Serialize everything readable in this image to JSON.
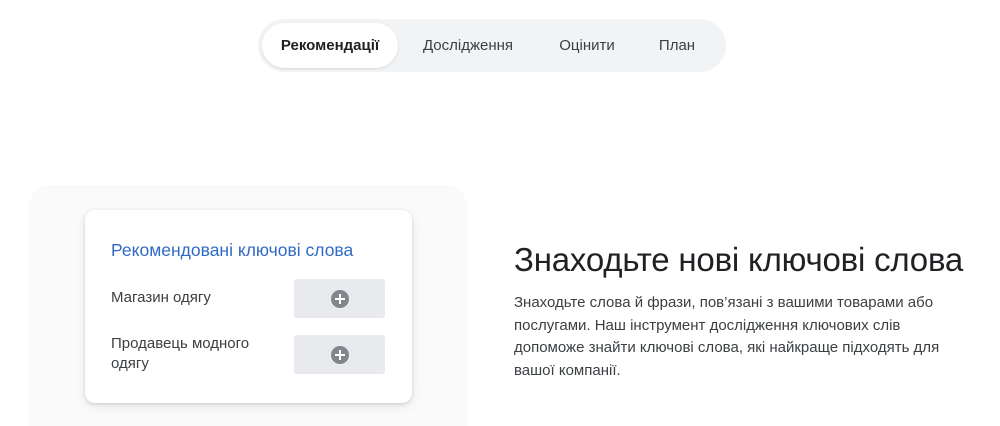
{
  "tabs": [
    {
      "label": "Рекомендації",
      "active": true
    },
    {
      "label": "Дослідження",
      "active": false
    },
    {
      "label": "Оцінити",
      "active": false
    },
    {
      "label": "План",
      "active": false
    }
  ],
  "card": {
    "title": "Рекомендовані ключові слова",
    "keywords": [
      {
        "label": "Магазин одягу",
        "icon": "plus-circle-icon"
      },
      {
        "label": "Продавець модного одягу",
        "icon": "plus-circle-icon"
      }
    ]
  },
  "content": {
    "headline": "Знаходьте нові ключові слова",
    "description": "Знаходьте слова й фрази, пов’язані з вашими товарами або послугами. Наш інструмент дослідження ключових слів допоможе знайти ключові слова, які найкраще підходять для вашої компанії."
  },
  "colors": {
    "accent": "#2f6bc4",
    "tab_bar": "#f1f3f4",
    "button_bg": "#e8eaed"
  }
}
